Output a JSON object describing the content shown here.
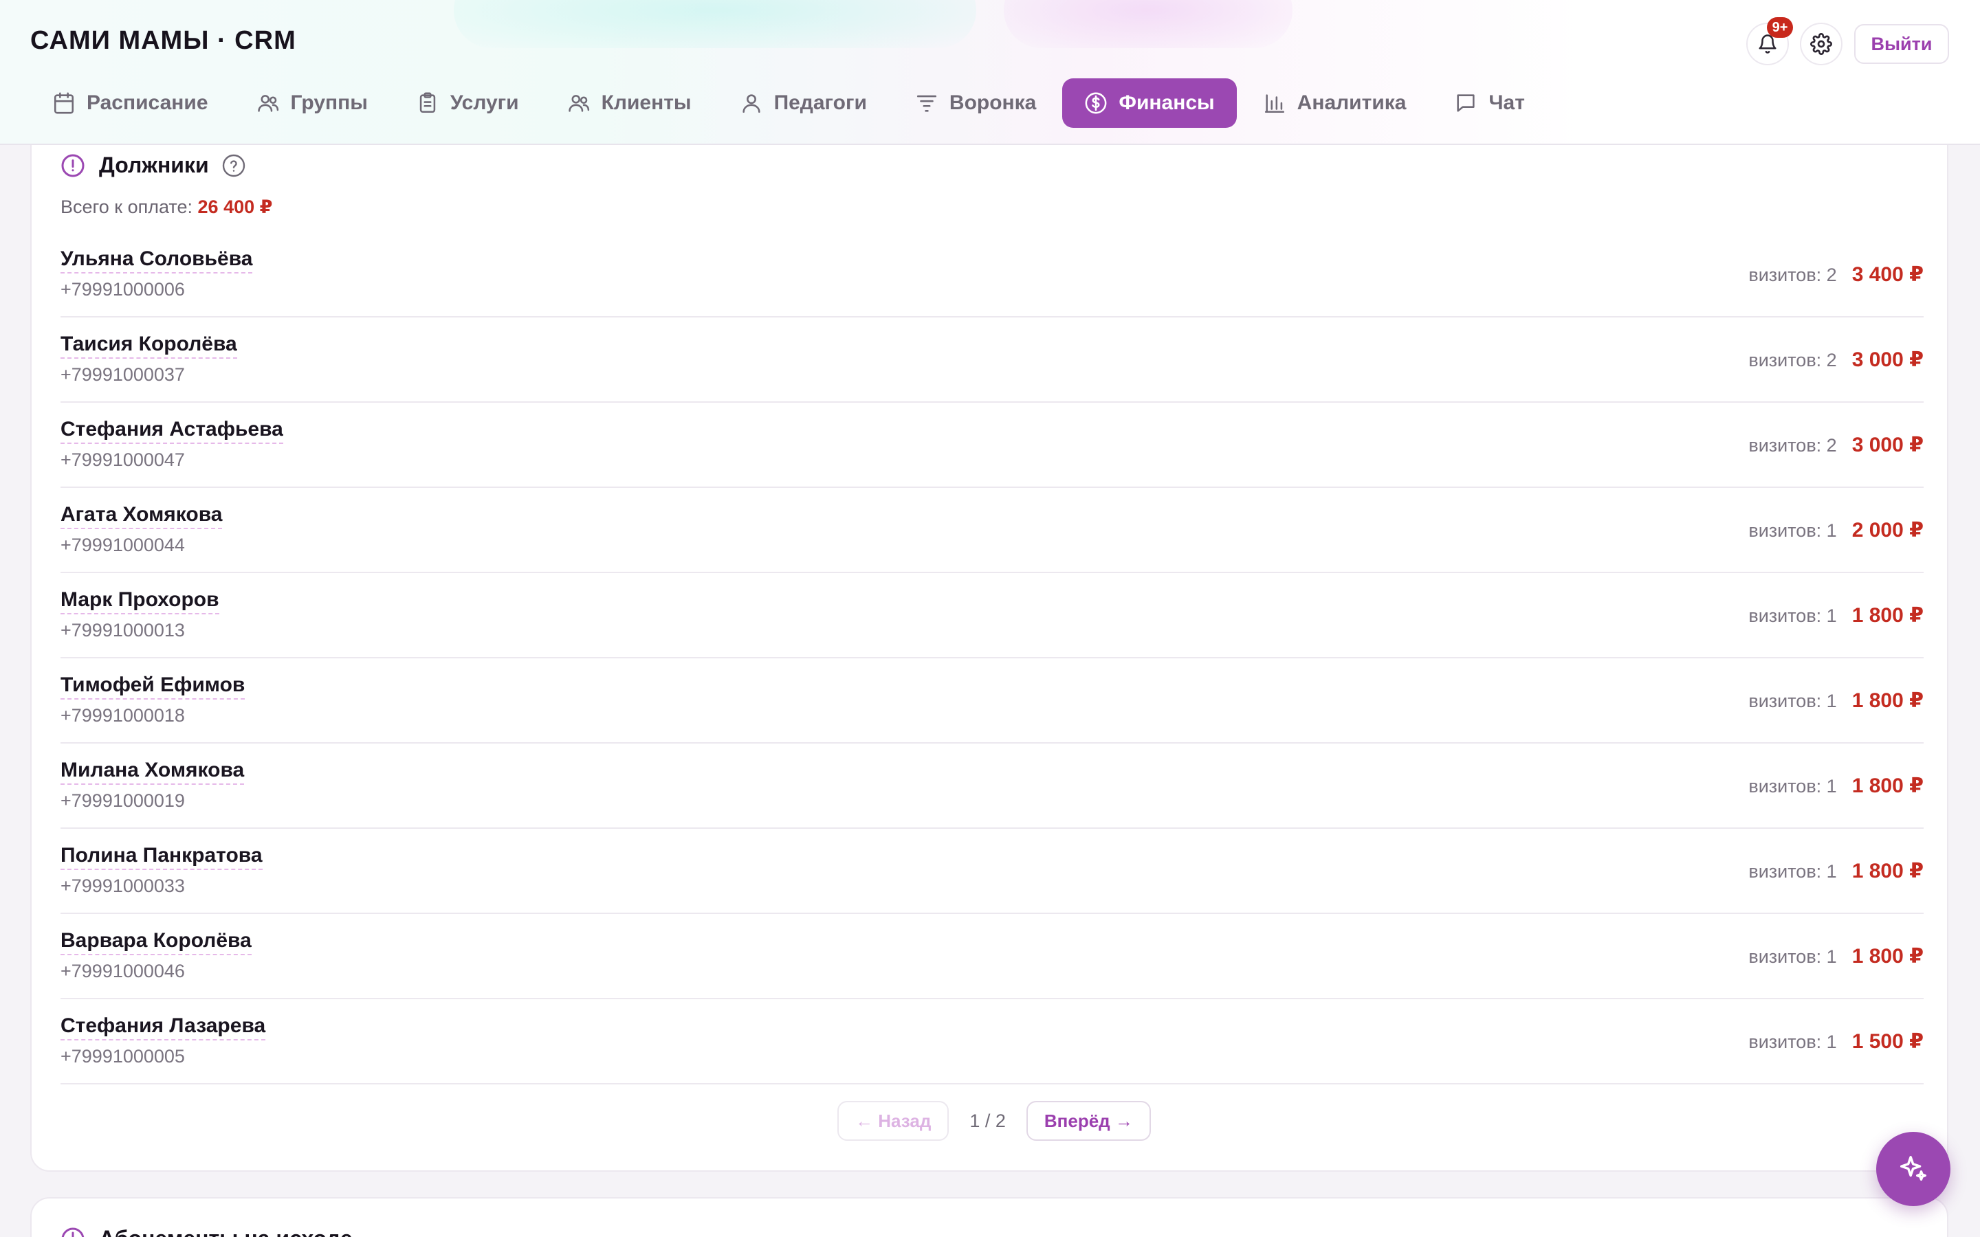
{
  "app": {
    "brand": "САМИ МАМЫ · CRM",
    "notifications_badge": "9+",
    "logout_label": "Выйти"
  },
  "nav": {
    "items": [
      {
        "label": "Расписание",
        "icon": "calendar-icon"
      },
      {
        "label": "Группы",
        "icon": "users-icon"
      },
      {
        "label": "Услуги",
        "icon": "clipboard-icon"
      },
      {
        "label": "Клиенты",
        "icon": "users-icon"
      },
      {
        "label": "Педагоги",
        "icon": "user-icon"
      },
      {
        "label": "Воронка",
        "icon": "filter-icon"
      },
      {
        "label": "Финансы",
        "icon": "dollar-circle-icon",
        "active": true
      },
      {
        "label": "Аналитика",
        "icon": "bar-chart-icon"
      },
      {
        "label": "Чат",
        "icon": "chat-icon"
      }
    ]
  },
  "debtors": {
    "title": "Должники",
    "total_label": "Всего к оплате:",
    "total_value": "26 400 ₽",
    "rows": [
      {
        "name": "Ульяна Соловьёва",
        "phone": "+79991000006",
        "visits": "визитов: 2",
        "amount": "3 400 ₽"
      },
      {
        "name": "Таисия Королёва",
        "phone": "+79991000037",
        "visits": "визитов: 2",
        "amount": "3 000 ₽"
      },
      {
        "name": "Стефания Астафьева",
        "phone": "+79991000047",
        "visits": "визитов: 2",
        "amount": "3 000 ₽"
      },
      {
        "name": "Агата Хомякова",
        "phone": "+79991000044",
        "visits": "визитов: 1",
        "amount": "2 000 ₽"
      },
      {
        "name": "Марк Прохоров",
        "phone": "+79991000013",
        "visits": "визитов: 1",
        "amount": "1 800 ₽"
      },
      {
        "name": "Тимофей Ефимов",
        "phone": "+79991000018",
        "visits": "визитов: 1",
        "amount": "1 800 ₽"
      },
      {
        "name": "Милана Хомякова",
        "phone": "+79991000019",
        "visits": "визитов: 1",
        "amount": "1 800 ₽"
      },
      {
        "name": "Полина Панкратова",
        "phone": "+79991000033",
        "visits": "визитов: 1",
        "amount": "1 800 ₽"
      },
      {
        "name": "Варвара Королёва",
        "phone": "+79991000046",
        "visits": "визитов: 1",
        "amount": "1 800 ₽"
      },
      {
        "name": "Стефания Лазарева",
        "phone": "+79991000005",
        "visits": "визитов: 1",
        "amount": "1 500 ₽"
      }
    ],
    "pager": {
      "prev_label": "← Назад",
      "info": "1 / 2",
      "next_label": "Вперёд →"
    }
  },
  "next_section": {
    "title": "Абонементы на исходе"
  },
  "colors": {
    "accent": "#9b48b2",
    "danger": "#c42b20"
  }
}
